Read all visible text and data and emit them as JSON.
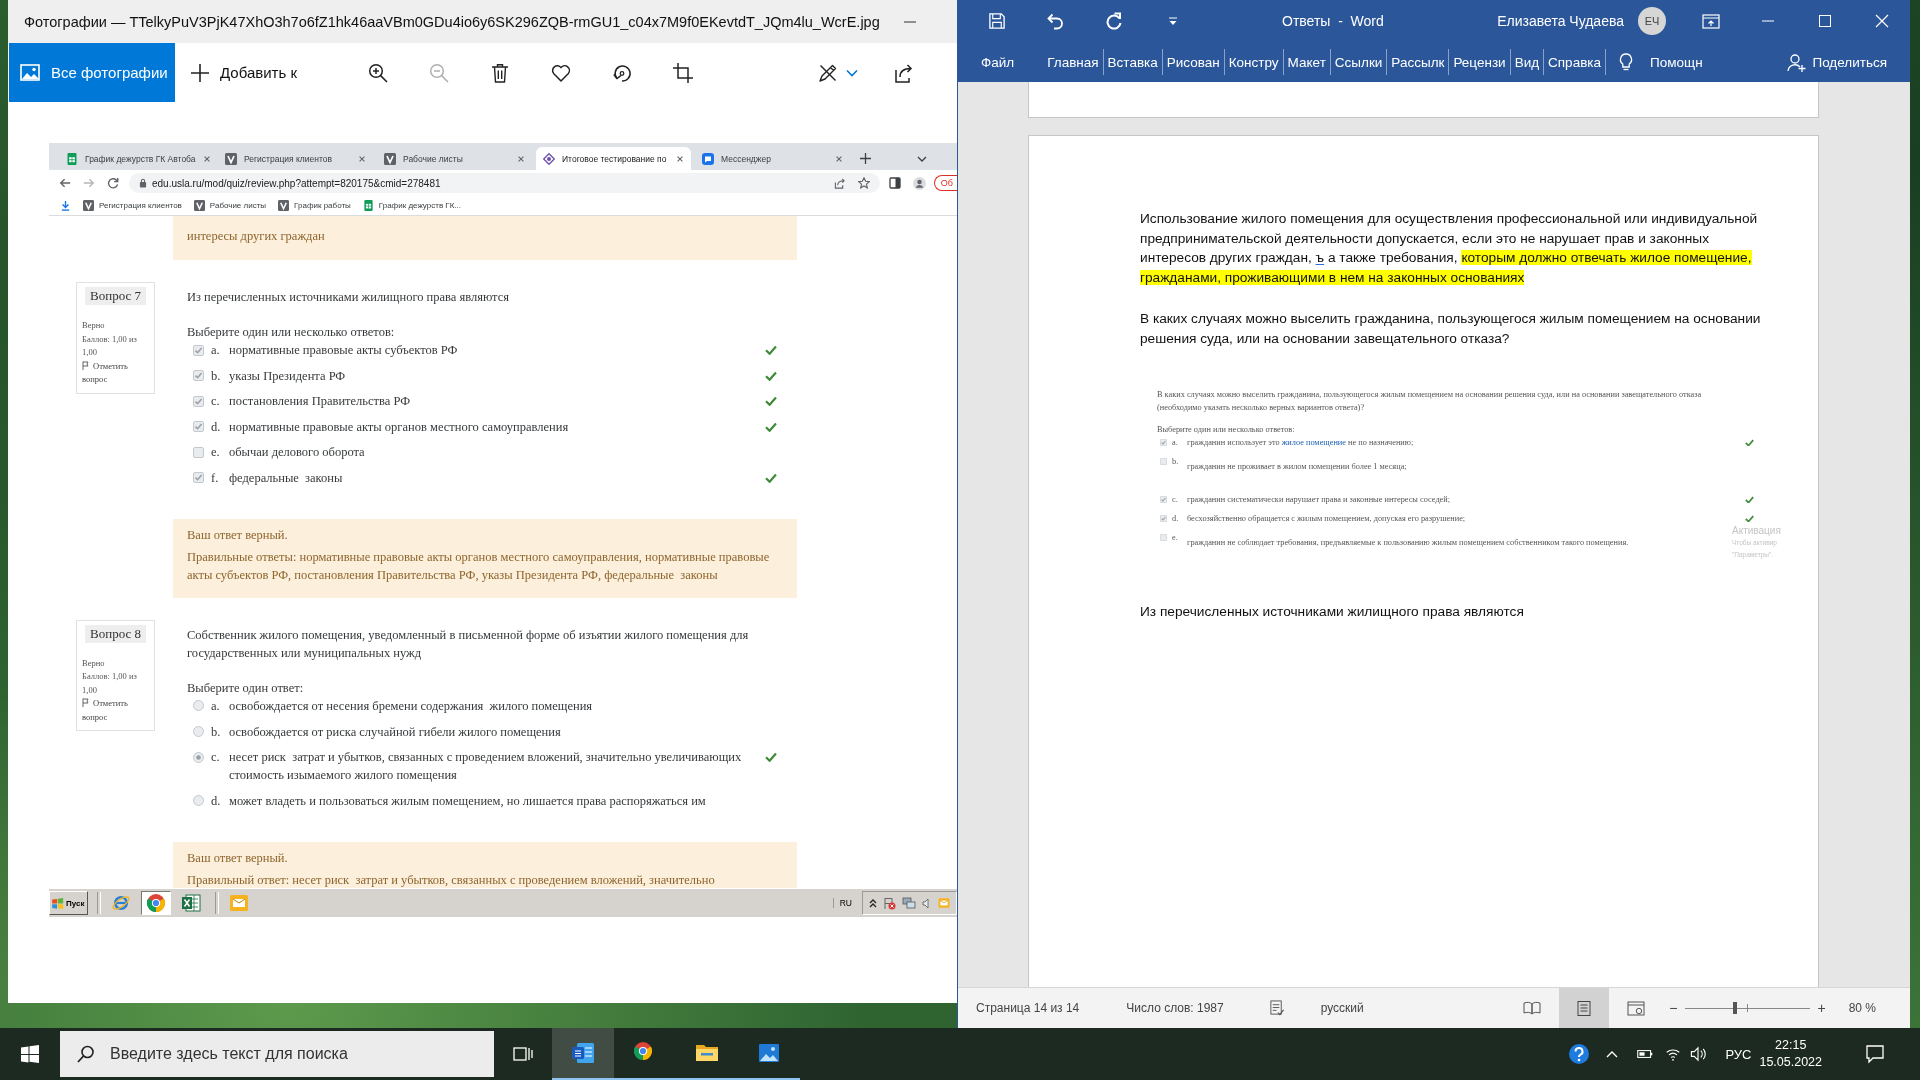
{
  "photos_app": {
    "title": "Фотографии — TTelkyPuV3PjK47XhO3h7o6fZ1hk46aaVBm0GDu4io6y6SK296ZQB-rmGU1_c04x7M9f0EKevtdT_JQm4lu_WcrE.jpg",
    "nav_button": {
      "label": "Все фотографии",
      "selected": true
    },
    "add_to": "Добавить к",
    "tools": [
      {
        "kind": "zoom-in",
        "disabled": false
      },
      {
        "kind": "zoom-out",
        "disabled": true
      },
      {
        "kind": "delete",
        "disabled": false
      },
      {
        "kind": "favorite",
        "disabled": false
      },
      {
        "kind": "rotate",
        "disabled": false
      },
      {
        "kind": "crop",
        "disabled": false
      },
      {
        "kind": "edit",
        "disabled": false
      },
      {
        "kind": "share",
        "disabled": false
      }
    ]
  },
  "browser": {
    "tabs": [
      {
        "kind": "sheets",
        "label": "График дежурств ГК Автоба",
        "selected": false
      },
      {
        "kind": "v",
        "label": "Регистрация клиентов",
        "selected": false
      },
      {
        "kind": "v",
        "label": "Рабочие листы",
        "selected": false
      },
      {
        "kind": "quiz",
        "label": "Итоговое тестирование по",
        "selected": true
      },
      {
        "kind": "chat",
        "label": "Мессенджер",
        "selected": false
      }
    ],
    "url": "edu.usla.ru/mod/quiz/review.php?attempt=820175&cmid=278481",
    "update_button": "Об",
    "bookmarks": [
      {
        "kind": "v",
        "label": "Регистрация клиентов"
      },
      {
        "kind": "v",
        "label": "Рабочие листы"
      },
      {
        "kind": "v",
        "label": "График работы"
      },
      {
        "kind": "sheets",
        "label": "График дежурств ГК..."
      }
    ]
  },
  "quiz": {
    "previous_feedback": "интересы других граждан",
    "questions": [
      {
        "number": "Вопрос 7",
        "status": "Верно",
        "grade": "Баллов: 1,00 из 1,00",
        "flag": "Отметить вопрос",
        "text": "Из перечисленных источниками жилищного права являются",
        "prompt": "Выберите один или несколько ответов:",
        "kind": "multiple",
        "options": [
          {
            "letter": "a.",
            "text": "нормативные правовые акты субъектов РФ",
            "selected": true,
            "correct": true
          },
          {
            "letter": "b.",
            "text": "указы Президента РФ",
            "selected": true,
            "correct": true
          },
          {
            "letter": "c.",
            "text": "постановления Правительства РФ",
            "selected": true,
            "correct": true
          },
          {
            "letter": "d.",
            "text": "нормативные правовые акты органов местного самоуправления",
            "selected": true,
            "correct": true
          },
          {
            "letter": "e.",
            "text": "обычаи делового оборота",
            "selected": false,
            "correct": false
          },
          {
            "letter": "f.",
            "text": "федеральные  законы",
            "selected": true,
            "correct": true
          }
        ],
        "feedback": {
          "verdict": "Ваш ответ верный.",
          "answer": "Правильные ответы: нормативные правовые акты органов местного самоуправления, нормативные правовые акты субъектов РФ, постановления Правительства РФ, указы Президента РФ, федеральные  законы"
        }
      },
      {
        "number": "Вопрос 8",
        "status": "Верно",
        "grade": "Баллов: 1,00 из 1,00",
        "flag": "Отметить вопрос",
        "text": "Собственник жилого помещения, уведомленный в письменной форме об изъятии жилого помещения для государственных или муниципальных нужд",
        "prompt": "Выберите один ответ:",
        "kind": "single",
        "options": [
          {
            "letter": "a.",
            "text": "освобождается от несения бремени содержания  жилого помещения",
            "selected": false,
            "correct": false
          },
          {
            "letter": "b.",
            "text": "освобождается от риска случайной гибели жилого помещения",
            "selected": false,
            "correct": false
          },
          {
            "letter": "c.",
            "text": "несет риск  затрат и убытков, связанных с проведением вложений, значительно увеличивающих стоимость изымаемого жилого помещения",
            "selected": true,
            "correct": true
          },
          {
            "letter": "d.",
            "text": "может владеть и пользоваться жилым помещением, но лишается права распоряжаться им",
            "selected": false,
            "correct": false
          }
        ],
        "feedback": {
          "verdict": "Ваш ответ верный.",
          "answer": "Правильный ответ: несет риск  затрат и убытков, связанных с проведением вложений, значительно"
        }
      }
    ]
  },
  "xp_taskbar": {
    "start": "Пуск",
    "apps": [
      {
        "kind": "ie",
        "active": false
      },
      {
        "kind": "chrome",
        "active": true
      },
      {
        "kind": "excel",
        "active": false
      },
      {
        "kind": "outlook",
        "active": false
      }
    ],
    "language": "RU"
  },
  "word": {
    "title": "Ответы  -  Word",
    "user": "Елизавета Чудаева",
    "initials": "ЕЧ",
    "file_button": "Файл",
    "tabs": [
      {
        "label": "Главная",
        "selected": false
      },
      {
        "label": "Вставка",
        "selected": false
      },
      {
        "label": "Рисован",
        "selected": false
      },
      {
        "label": "Констру",
        "selected": false
      },
      {
        "label": "Макет",
        "selected": false
      },
      {
        "label": "Ссылки",
        "selected": false
      },
      {
        "label": "Рассылк",
        "selected": false
      },
      {
        "label": "Рецензи",
        "selected": false
      },
      {
        "label": "Вид",
        "selected": false
      },
      {
        "label": "Справка",
        "selected": false
      }
    ],
    "tell_me": "Помощн",
    "share": "Поделиться",
    "document": {
      "blocks": [
        {
          "kind": "text",
          "runs": [
            {
              "kind": "plain",
              "text": "Использование жилого помещения для осуществления профессиональной или индивидуальной предпринимательской деятельности допускается, если это не нарушает прав и законных\nинтересов других граждан, "
            },
            {
              "kind": "grammar",
              "text": "ъ"
            },
            {
              "kind": "plain",
              "text": " а также требования, "
            },
            {
              "kind": "highlight",
              "text": "которым должно отвечать жилое помещение, гражданами, проживающими в нем на законных основаниях"
            }
          ]
        },
        {
          "kind": "text",
          "runs": [
            {
              "kind": "plain",
              "text": "В каких случаях можно выселить гражданина, пользующегося жилым помещением на основании решения суда, или на основании завещательного отказа?"
            }
          ]
        },
        {
          "kind": "image",
          "question": "В каких случаях можно выселить гражданина, пользующегося жилым помещением на основании решения суда, или на основании завещательного отказа (необходимо указать несколько верных вариантов ответа)?",
          "prompt": "Выберите один или несколько ответов:",
          "options": [
            {
              "letter": "a.",
              "kind": "inline",
              "runs": [
                {
                  "kind": "plain",
                  "text": "гражданин использует это "
                },
                {
                  "kind": "link",
                  "text": "жилое помещение"
                },
                {
                  "kind": "plain",
                  "text": " не по назначению;"
                }
              ],
              "selected": true,
              "correct": true
            },
            {
              "letter": "b.",
              "kind": "paragraph",
              "runs": [
                {
                  "kind": "plain",
                  "text": "гражданин не проживает в жилом помещении более 1 месяца;"
                }
              ],
              "selected": false,
              "correct": false
            },
            {
              "letter": "c.",
              "kind": "inline",
              "runs": [
                {
                  "kind": "plain",
                  "text": "гражданин систематически нарушает права и законные интересы соседей;"
                }
              ],
              "selected": true,
              "correct": true
            },
            {
              "letter": "d.",
              "kind": "inline",
              "runs": [
                {
                  "kind": "plain",
                  "text": "бесхозяйственно обращается с жилым помещением, допуская его разрушение;"
                }
              ],
              "selected": true,
              "correct": true
            },
            {
              "letter": "e.",
              "kind": "paragraph",
              "runs": [
                {
                  "kind": "plain",
                  "text": "гражданин не соблюдает требования, предъявляемые к пользованию жилым помещением собственником такого помещения."
                }
              ],
              "selected": false,
              "correct": false
            }
          ],
          "notice": [
            "Активация",
            "Чтобы активир",
            "\"Параметры\"."
          ]
        },
        {
          "kind": "text",
          "runs": [
            {
              "kind": "plain",
              "text": "Из перечисленных источниками жилищного права являются"
            }
          ]
        }
      ]
    },
    "status_bar": {
      "page": "Страница 14 из 14",
      "words": "Число слов: 1987",
      "language": "русский",
      "views": [
        {
          "kind": "read",
          "selected": false
        },
        {
          "kind": "print",
          "selected": true
        },
        {
          "kind": "web",
          "selected": false
        }
      ],
      "zoom": {
        "minus": "−",
        "plus": "+",
        "level": 0.4,
        "reading": "80 %"
      }
    }
  },
  "taskbar": {
    "search_placeholder": "Введите здесь текст для поиска",
    "apps": [
      {
        "kind": "word",
        "active": true,
        "running": true
      },
      {
        "kind": "chrome",
        "active": false,
        "running": true
      },
      {
        "kind": "explorer",
        "active": false,
        "running": true
      },
      {
        "kind": "photos",
        "active": false,
        "running": true
      }
    ],
    "language": "РУС",
    "time": "22:15",
    "date": "15.05.2022"
  }
}
